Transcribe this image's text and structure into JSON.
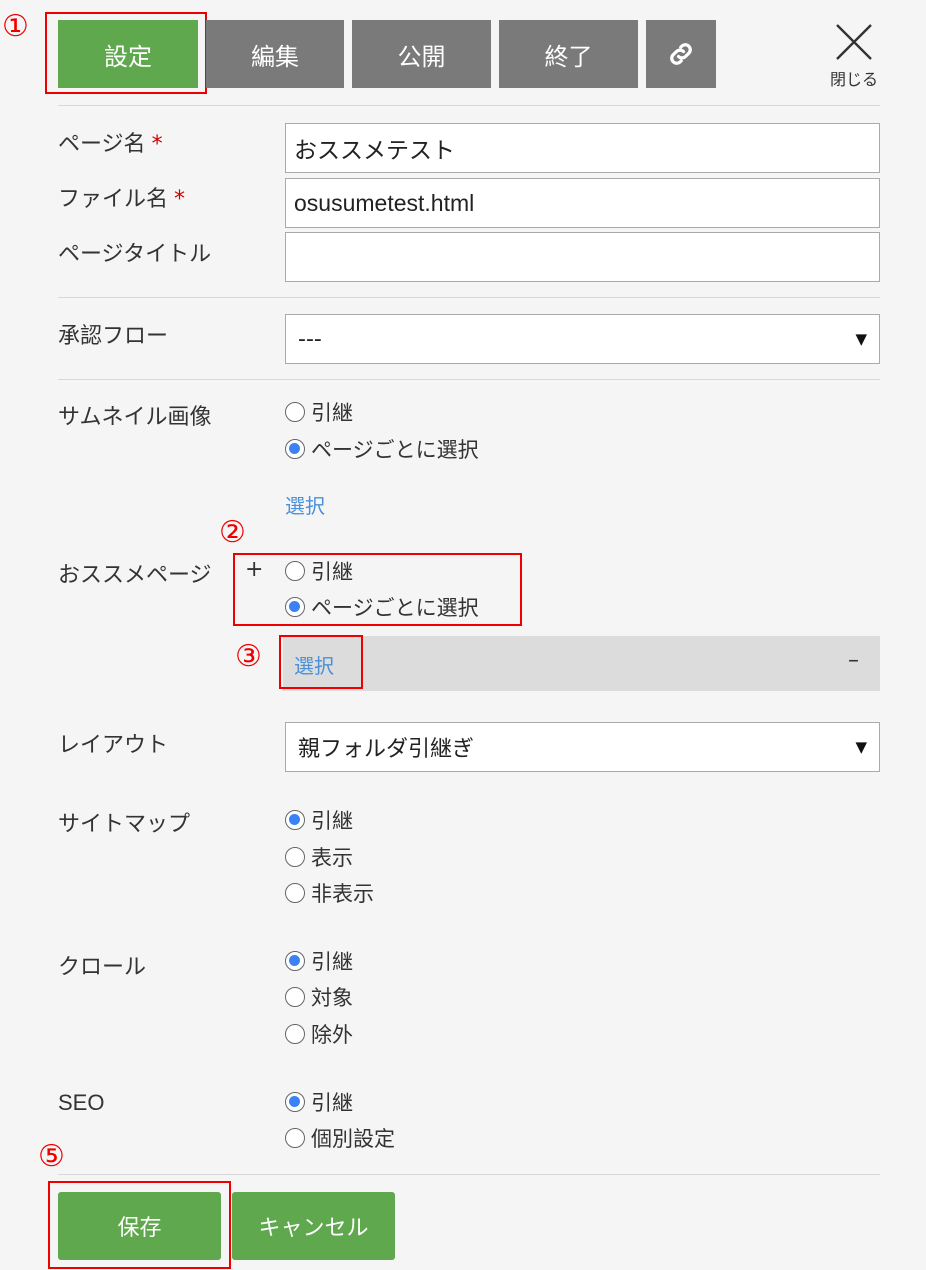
{
  "annotations": {
    "n1": "①",
    "n2": "②",
    "n3": "③",
    "n5": "⑤"
  },
  "tabs": {
    "settings": "設定",
    "edit": "編集",
    "publish": "公開",
    "finish": "終了",
    "link_icon": "link-icon"
  },
  "close": {
    "label": "閉じる"
  },
  "form": {
    "page_name": {
      "label": "ページ名",
      "required": "*",
      "value": "おススメテスト"
    },
    "file_name": {
      "label": "ファイル名",
      "required": "*",
      "value": "osusumetest.html"
    },
    "page_title": {
      "label": "ページタイトル",
      "value": ""
    },
    "approval_flow": {
      "label": "承認フロー",
      "value": "---"
    },
    "thumbnail": {
      "label": "サムネイル画像",
      "options": [
        "引継",
        "ページごとに選択"
      ],
      "selected": 1,
      "select_link": "選択"
    },
    "recommend": {
      "label": "おススメページ",
      "expand": "+",
      "options": [
        "引継",
        "ページごとに選択"
      ],
      "selected": 1,
      "select_link": "選択",
      "collapse": "–"
    },
    "layout": {
      "label": "レイアウト",
      "value": "親フォルダ引継ぎ"
    },
    "sitemap": {
      "label": "サイトマップ",
      "options": [
        "引継",
        "表示",
        "非表示"
      ],
      "selected": 0
    },
    "crawl": {
      "label": "クロール",
      "options": [
        "引継",
        "対象",
        "除外"
      ],
      "selected": 0
    },
    "seo": {
      "label": "SEO",
      "options": [
        "引継",
        "個別設定"
      ],
      "selected": 0
    }
  },
  "footer": {
    "save": "保存",
    "cancel": "キャンセル"
  },
  "colors": {
    "tab_active": "#5fa84e",
    "tab_inactive": "#7a7a7a",
    "radio_selected": "#3b82f6",
    "link": "#4a90d9",
    "annotation": "#ee0000"
  }
}
